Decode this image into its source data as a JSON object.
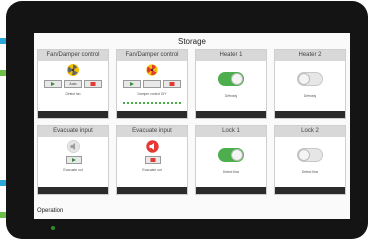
{
  "screen": {
    "title": "Storage",
    "footer_label": "Operation"
  },
  "cards": [
    {
      "title": "Fan/Damper control",
      "caption": "Detect fan",
      "buttons": [
        "",
        "Auto",
        ""
      ]
    },
    {
      "title": "Fan/Damper control",
      "caption": "Damper control DIY",
      "buttons": [
        "",
        "",
        ""
      ]
    },
    {
      "title": "Heater 1",
      "caption": "Defrosty",
      "state": "on"
    },
    {
      "title": "Heater 2",
      "caption": "Defrosty",
      "state": "off"
    },
    {
      "title": "Evacuate input",
      "caption": "Evacuate out"
    },
    {
      "title": "Evacuate input",
      "caption": "Evacuate out"
    },
    {
      "title": "Lock 1",
      "caption": "Detect flow",
      "state": "on"
    },
    {
      "title": "Lock 2",
      "caption": "Detect flow",
      "state": "off"
    }
  ],
  "colors": {
    "green": "#4cae4c",
    "red": "#e53935",
    "fan_yellow": "#f2c200",
    "bezel": "#141414",
    "accent_blue": "#2aa8d8",
    "accent_green": "#6cc04a"
  },
  "icons": {
    "fan": "fan-icon",
    "speaker": "speaker-icon",
    "toggle": "toggle-switch"
  }
}
